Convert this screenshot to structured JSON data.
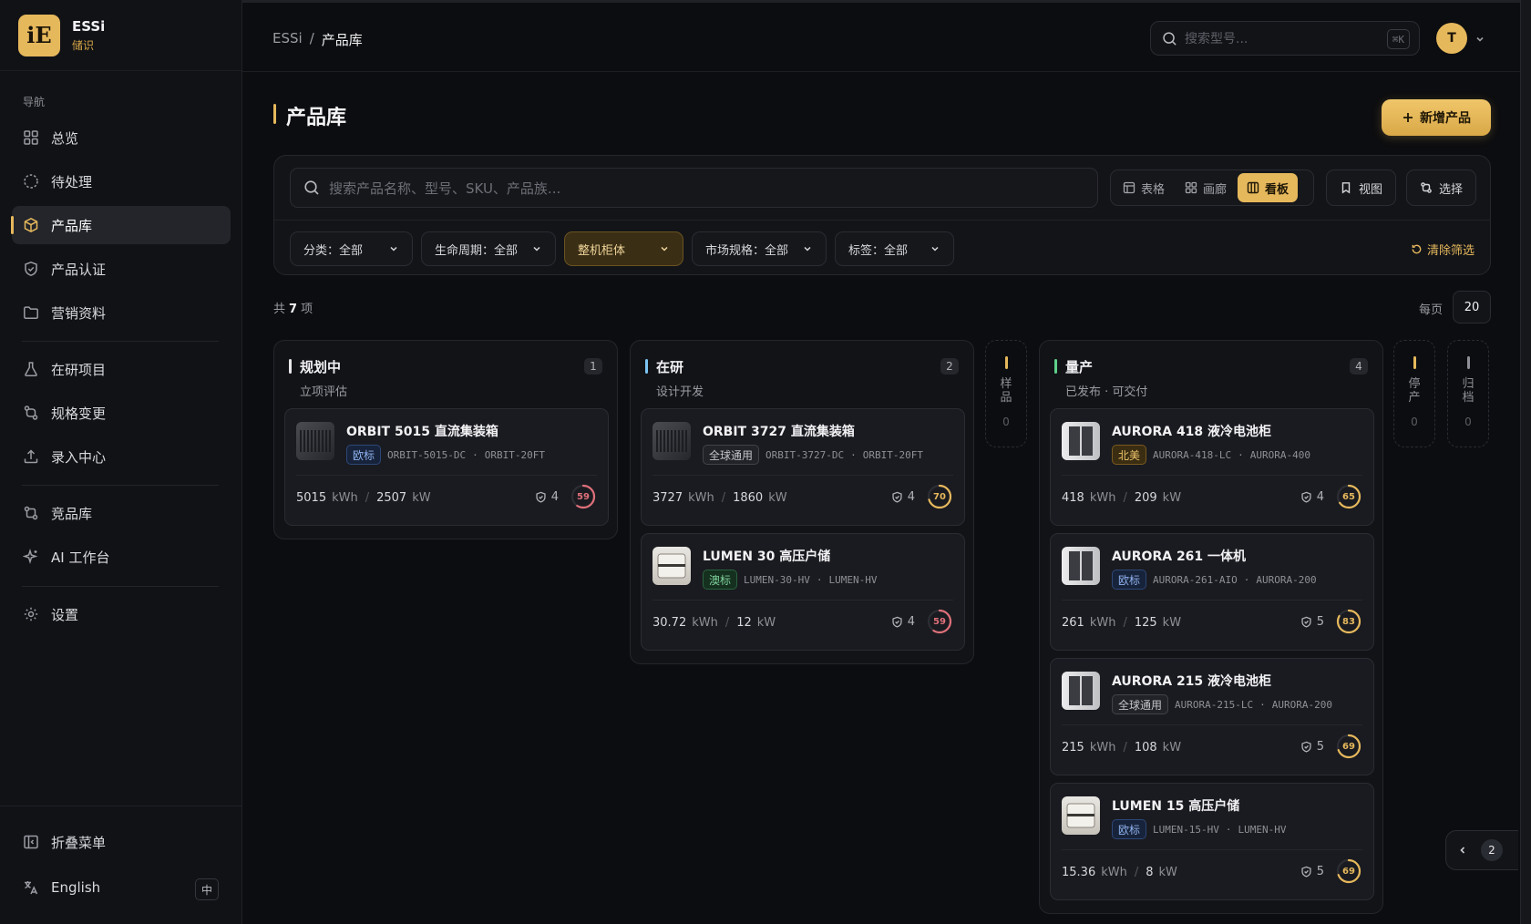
{
  "brand": {
    "name": "ESSi",
    "sub": "储识",
    "logo": "iE"
  },
  "nav": {
    "heading": "导航",
    "items": [
      {
        "label": "总览",
        "icon": "grid-icon"
      },
      {
        "label": "待处理",
        "icon": "pending-icon"
      },
      {
        "label": "产品库",
        "icon": "box-icon",
        "active": true
      },
      {
        "label": "产品认证",
        "icon": "shield-icon"
      },
      {
        "label": "营销资料",
        "icon": "folder-icon"
      },
      {
        "label": "在研项目",
        "icon": "flask-icon"
      },
      {
        "label": "规格变更",
        "icon": "git-compare-icon"
      },
      {
        "label": "录入中心",
        "icon": "upload-icon"
      },
      {
        "label": "竞品库",
        "icon": "compare-icon"
      },
      {
        "label": "AI 工作台",
        "icon": "sparkle-icon"
      },
      {
        "label": "设置",
        "icon": "gear-icon"
      }
    ],
    "collapse": "折叠菜单",
    "language": "English",
    "lang_toggle": "中"
  },
  "header": {
    "breadcrumb_root": "ESSi",
    "breadcrumb_sep": "/",
    "breadcrumb_current": "产品库",
    "search_placeholder": "搜索型号...",
    "search_kbd": "⌘K",
    "avatar": "T"
  },
  "page": {
    "title": "产品库",
    "add_button": "新增产品",
    "search_placeholder": "搜索产品名称、型号、SKU、产品族...",
    "views": [
      {
        "label": "表格",
        "icon": "table-icon"
      },
      {
        "label": "画廊",
        "icon": "gallery-icon"
      },
      {
        "label": "看板",
        "icon": "kanban-icon",
        "active": true
      }
    ],
    "view_button": "视图",
    "select_button": "选择",
    "filters": [
      {
        "label": "分类：全部"
      },
      {
        "label": "生命周期：全部"
      },
      {
        "label": "整机柜体",
        "active": true
      },
      {
        "label": "市场规格：全部"
      },
      {
        "label": "标签：全部"
      }
    ],
    "clear_filters": "清除筛选",
    "count_prefix": "共",
    "count": "7",
    "count_suffix": "项",
    "per_page_label": "每页",
    "per_page": "20"
  },
  "kanban": {
    "columns": [
      {
        "title": "规划中",
        "subtitle": "立项评估",
        "count": "1",
        "color": "#e7e7ea",
        "cards": [
          {
            "name": "ORBIT 5015 直流集装箱",
            "tag": "欧标",
            "tag_type": "eu",
            "sku": "ORBIT-5015-DC",
            "family": "ORBIT-20FT",
            "energy": "5015",
            "energy_unit": "kWh",
            "power": "2507",
            "power_unit": "kW",
            "certs": "4",
            "score": 59,
            "thumb": "cont"
          }
        ]
      },
      {
        "title": "在研",
        "subtitle": "设计开发",
        "count": "2",
        "color": "#7cc4f2",
        "cards": [
          {
            "name": "ORBIT 3727 直流集装箱",
            "tag": "全球通用",
            "tag_type": "gl",
            "sku": "ORBIT-3727-DC",
            "family": "ORBIT-20FT",
            "energy": "3727",
            "energy_unit": "kWh",
            "power": "1860",
            "power_unit": "kW",
            "certs": "4",
            "score": 70,
            "thumb": "cont"
          },
          {
            "name": "LUMEN 30 高压户储",
            "tag": "澳标",
            "tag_type": "au",
            "sku": "LUMEN-30-HV",
            "family": "LUMEN-HV",
            "energy": "30.72",
            "energy_unit": "kWh",
            "power": "12",
            "power_unit": "kW",
            "certs": "4",
            "score": 59,
            "thumb": "wall"
          }
        ]
      },
      {
        "title": "量产",
        "subtitle": "已发布 · 可交付",
        "count": "4",
        "color": "#5fd08a",
        "cards": [
          {
            "name": "AURORA 418 液冷电池柜",
            "tag": "北美",
            "tag_type": "na",
            "sku": "AURORA-418-LC",
            "family": "AURORA-400",
            "energy": "418",
            "energy_unit": "kWh",
            "power": "209",
            "power_unit": "kW",
            "certs": "4",
            "score": 65,
            "thumb": "cab"
          },
          {
            "name": "AURORA 261 一体机",
            "tag": "欧标",
            "tag_type": "eu",
            "sku": "AURORA-261-AIO",
            "family": "AURORA-200",
            "energy": "261",
            "energy_unit": "kWh",
            "power": "125",
            "power_unit": "kW",
            "certs": "5",
            "score": 83,
            "thumb": "cab"
          },
          {
            "name": "AURORA 215 液冷电池柜",
            "tag": "全球通用",
            "tag_type": "gl",
            "sku": "AURORA-215-LC",
            "family": "AURORA-200",
            "energy": "215",
            "energy_unit": "kWh",
            "power": "108",
            "power_unit": "kW",
            "certs": "5",
            "score": 69,
            "thumb": "cab"
          },
          {
            "name": "LUMEN 15 高压户储",
            "tag": "欧标",
            "tag_type": "eu",
            "sku": "LUMEN-15-HV",
            "family": "LUMEN-HV",
            "energy": "15.36",
            "energy_unit": "kWh",
            "power": "8",
            "power_unit": "kW",
            "certs": "5",
            "score": 69,
            "thumb": "wall"
          }
        ]
      }
    ],
    "collapsed": [
      {
        "label": "样品",
        "count": "0",
        "color": "#e6b85c"
      },
      {
        "label": "停产",
        "count": "0",
        "color": "#e6b85c"
      },
      {
        "label": "归档",
        "count": "0",
        "color": "#8e9097"
      }
    ]
  },
  "pager": {
    "page": "2"
  }
}
